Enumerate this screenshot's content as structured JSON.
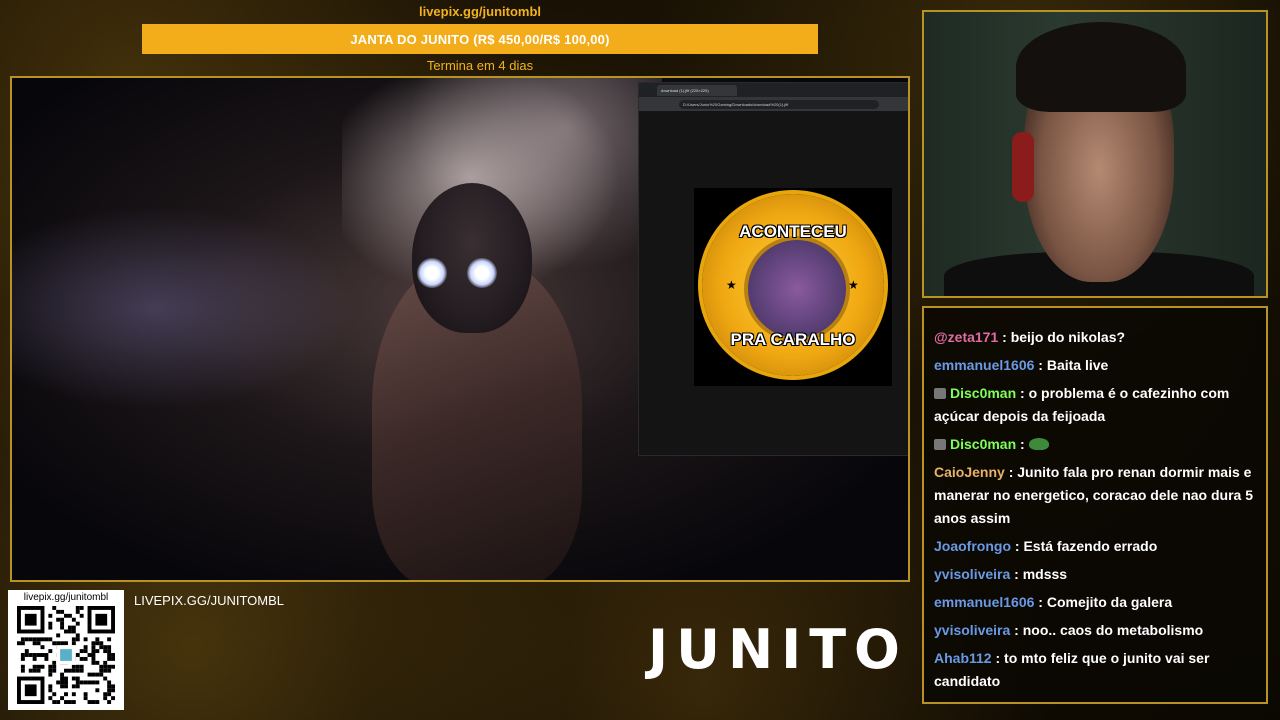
{
  "goal": {
    "url": "livepix.gg/junitombl",
    "text": "JANTA DO JUNITO (R$ 450,00/R$ 100,00)",
    "fill": 1.0,
    "ends": "Termina em 4 dias"
  },
  "browser": {
    "tab_title": "download (1).jfif (225×225)",
    "address": "D:/Users/Junio%20Gaming/Downloads/download%20(1).jfif"
  },
  "meme": {
    "top_text": "ACONTECEU",
    "bottom_text": "PRA CARALHO"
  },
  "chat": [
    {
      "user": "@zeta171",
      "color": "#e26aa4",
      "badge": false,
      "text": "beijo do nikolas?"
    },
    {
      "user": "emmanuel1606",
      "color": "#6a9ae6",
      "badge": false,
      "text": "Baita live"
    },
    {
      "user": "Disc0man",
      "color": "#7dff5a",
      "badge": true,
      "text": "o problema é o cafezinho com açúcar depois da feijoada"
    },
    {
      "user": "Disc0man",
      "color": "#7dff5a",
      "badge": true,
      "text": "",
      "emote": "frog-emote"
    },
    {
      "user": "CaioJenny",
      "color": "#e8b26a",
      "badge": false,
      "text": "Junito fala pro renan dormir mais e manerar no energetico, coracao dele nao dura 5 anos assim"
    },
    {
      "user": "Joaofrongo",
      "color": "#6a9ae6",
      "badge": false,
      "text": "Está fazendo errado"
    },
    {
      "user": "yvisoliveira",
      "color": "#6a9ae6",
      "badge": false,
      "text": "mdsss"
    },
    {
      "user": "emmanuel1606",
      "color": "#6a9ae6",
      "badge": false,
      "text": "Comejito da galera"
    },
    {
      "user": "yvisoliveira",
      "color": "#6a9ae6",
      "badge": false,
      "text": "noo.. caos do metabolismo"
    },
    {
      "user": "Ahab112",
      "color": "#6a9ae6",
      "badge": false,
      "text": "to mto feliz que o junito vai ser candidato"
    }
  ],
  "qr": {
    "label": "livepix.gg/junitombl"
  },
  "livepix_label": "LIVEPIX.GG/JUNITOMBL",
  "logo": "JUNITO",
  "colors": {
    "accent": "#f4ad1a",
    "frame": "#b89322"
  }
}
